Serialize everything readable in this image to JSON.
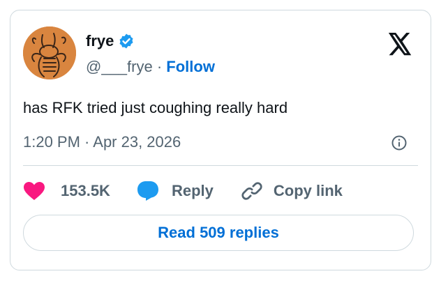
{
  "tweet": {
    "author": {
      "display_name": "frye",
      "verified": true,
      "handle": "@___frye",
      "separator": " · ",
      "follow_label": "Follow",
      "avatar_icon": "cartoon-avatar"
    },
    "platform_icon": "x-logo-icon",
    "text": "has RFK tried just coughing really hard",
    "timestamp": "1:20 PM · Apr 23, 2026",
    "info_icon": "info-icon",
    "actions": {
      "likes_count": "153.5K",
      "reply_label": "Reply",
      "copy_link_label": "Copy link"
    },
    "read_replies_label": "Read 509 replies"
  },
  "colors": {
    "accent_blue": "#006fd6",
    "verified_blue": "#1d9bf0",
    "heart_pink": "#f91880",
    "text_primary": "#0f1419",
    "text_secondary": "#536471",
    "border": "#cfd9de",
    "avatar_orange": "#d9853f"
  }
}
